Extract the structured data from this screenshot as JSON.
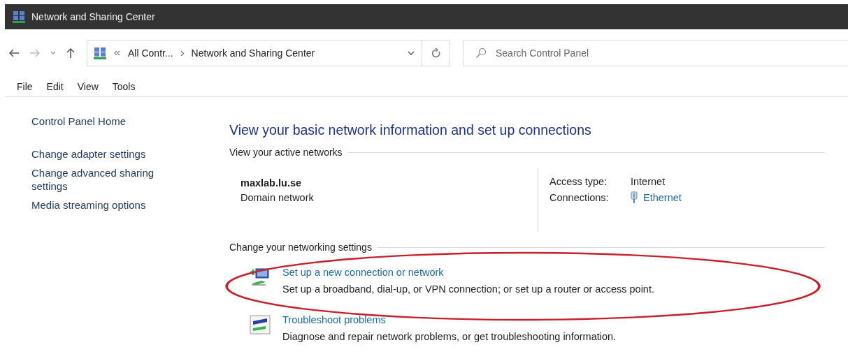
{
  "window": {
    "title": "Network and Sharing Center"
  },
  "address_bar": {
    "crumbs": [
      "All Contr...",
      "Network and Sharing Center"
    ]
  },
  "search": {
    "placeholder": "Search Control Panel"
  },
  "menu": [
    "File",
    "Edit",
    "View",
    "Tools"
  ],
  "sidebar": {
    "items": [
      {
        "label": "Control Panel Home",
        "kind": "home"
      },
      {
        "label": "Change adapter settings",
        "kind": "link"
      },
      {
        "label": "Change advanced sharing settings",
        "kind": "link"
      },
      {
        "label": "Media streaming options",
        "kind": "link"
      }
    ]
  },
  "heading": "View your basic network information and set up connections",
  "active_networks": {
    "title": "View your active networks",
    "name": "maxlab.lu.se",
    "category": "Domain network",
    "access_type_label": "Access type:",
    "access_type": "Internet",
    "connections_label": "Connections:",
    "connection": "Ethernet"
  },
  "settings": {
    "title": "Change your networking settings",
    "tasks": [
      {
        "kind": "new-connection",
        "link": "Set up a new connection or network",
        "description": "Set up a broadband, dial-up, or VPN connection; or set up a router or access point.",
        "circled": true
      },
      {
        "kind": "troubleshoot",
        "link": "Troubleshoot problems",
        "description": "Diagnose and repair network problems, or get troubleshooting information.",
        "circled": false
      }
    ]
  }
}
